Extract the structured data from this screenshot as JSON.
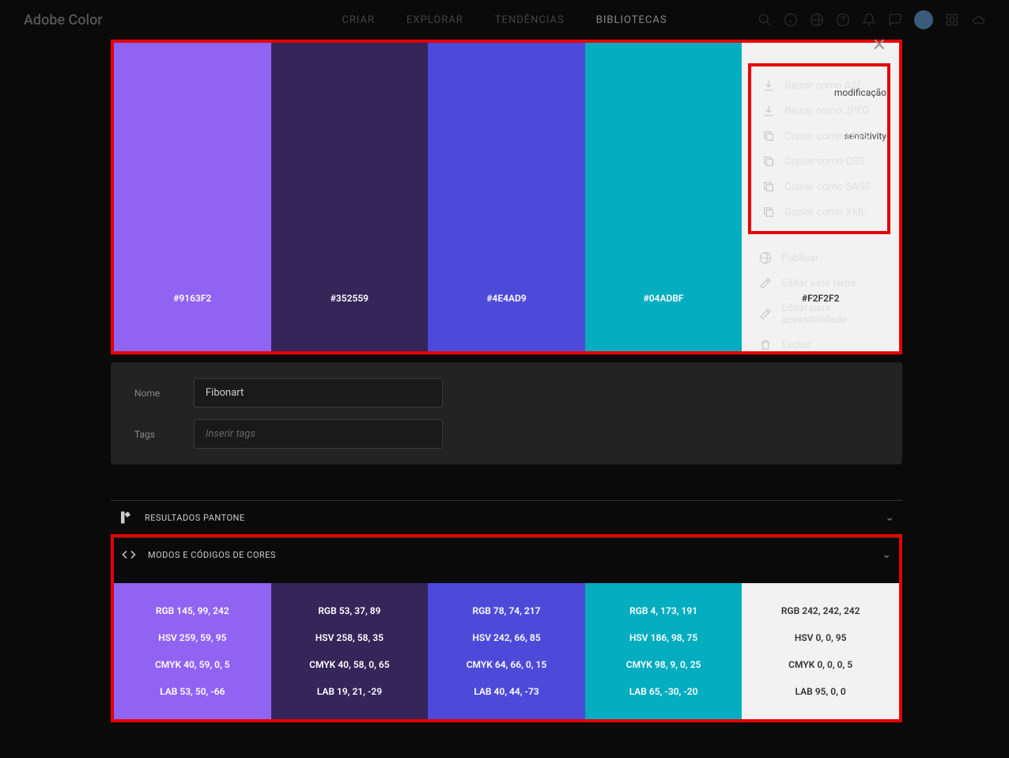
{
  "header": {
    "logo": "Adobe Color",
    "nav": [
      "CRIAR",
      "EXPLORAR",
      "TENDÊNCIAS",
      "BIBLIOTECAS"
    ]
  },
  "close_x": "✕",
  "palette": [
    {
      "hex": "#9163F2",
      "text_class": "dark"
    },
    {
      "hex": "#352559",
      "text_class": "dark"
    },
    {
      "hex": "#4E4AD9",
      "text_class": "dark"
    },
    {
      "hex": "#04ADBF",
      "text_class": "dark"
    },
    {
      "hex": "#F2F2F2",
      "text_class": "light"
    }
  ],
  "behind": {
    "line1": "modificação",
    "line2": "sensitivity"
  },
  "menu": {
    "section1": [
      {
        "icon": "download",
        "label": "Baixar como ASE"
      },
      {
        "icon": "download",
        "label": "Baixar como JPEG"
      },
      {
        "icon": "copy",
        "label": "Copiar como LESS"
      },
      {
        "icon": "copy",
        "label": "Copiar como CSS"
      },
      {
        "icon": "copy",
        "label": "Copiar como SASS"
      },
      {
        "icon": "copy",
        "label": "Copiar como XML"
      }
    ],
    "section2": [
      {
        "icon": "globe",
        "label": "Publicar"
      },
      {
        "icon": "edit",
        "label": "Editar este tema"
      },
      {
        "icon": "edit",
        "label": "Editar para acessibilidade"
      },
      {
        "icon": "trash",
        "label": "Excluir"
      }
    ]
  },
  "form": {
    "name_label": "Nome",
    "name_value": "Fibonart",
    "tags_label": "Tags",
    "tags_placeholder": "Inserir tags"
  },
  "accordions": {
    "pantone": "RESULTADOS PANTONE",
    "codes": "MODOS E CÓDIGOS DE CORES"
  },
  "codes": [
    {
      "bg": "#9163F2",
      "text_class": "dark",
      "rgb": "RGB 145, 99, 242",
      "hsv": "HSV 259, 59, 95",
      "cmyk": "CMYK 40, 59, 0, 5",
      "lab": "LAB 53, 50, -66"
    },
    {
      "bg": "#352559",
      "text_class": "dark",
      "rgb": "RGB 53, 37, 89",
      "hsv": "HSV 258, 58, 35",
      "cmyk": "CMYK 40, 58, 0, 65",
      "lab": "LAB 19, 21, -29"
    },
    {
      "bg": "#4E4AD9",
      "text_class": "dark",
      "rgb": "RGB 78, 74, 217",
      "hsv": "HSV 242, 66, 85",
      "cmyk": "CMYK 64, 66, 0, 15",
      "lab": "LAB 40, 44, -73"
    },
    {
      "bg": "#04ADBF",
      "text_class": "dark",
      "rgb": "RGB 4, 173, 191",
      "hsv": "HSV 186, 98, 75",
      "cmyk": "CMYK 98, 9, 0, 25",
      "lab": "LAB 65, -30, -20"
    },
    {
      "bg": "#F2F2F2",
      "text_class": "light",
      "rgb": "RGB 242, 242, 242",
      "hsv": "HSV 0, 0, 95",
      "cmyk": "CMYK 0, 0, 0, 5",
      "lab": "LAB 95, 0, 0"
    }
  ]
}
